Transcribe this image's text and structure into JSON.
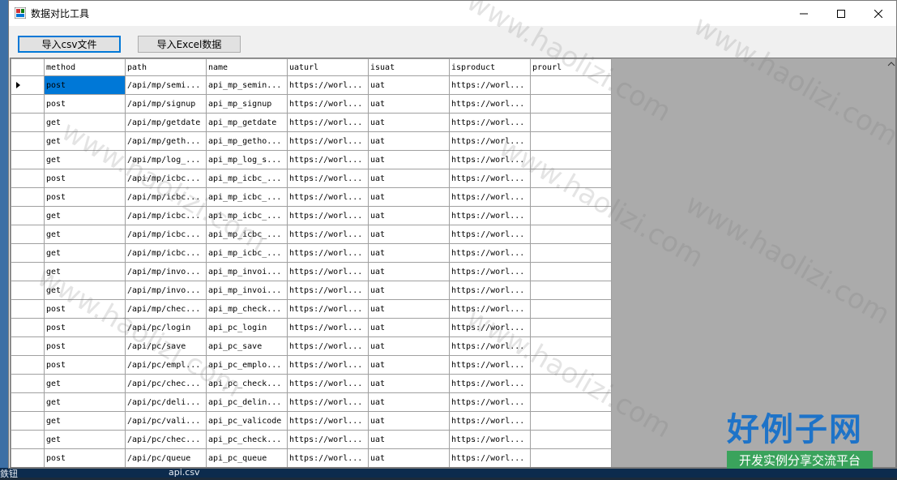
{
  "window": {
    "title": "数据对比工具",
    "controls": [
      "minimize",
      "maximize",
      "close"
    ]
  },
  "toolbar": {
    "import_csv_label": "导入csv文件",
    "import_excel_label": "导入Excel数据"
  },
  "grid": {
    "columns": [
      "method",
      "path",
      "name",
      "uaturl",
      "isuat",
      "isproduct",
      "prourl"
    ],
    "rows": [
      [
        "post",
        "/api/mp/semi...",
        "api_mp_semin...",
        "https://worl...",
        "uat",
        "https://worl...",
        ""
      ],
      [
        "post",
        "/api/mp/signup",
        "api_mp_signup",
        "https://worl...",
        "uat",
        "https://worl...",
        ""
      ],
      [
        "get",
        "/api/mp/getdate",
        "api_mp_getdate",
        "https://worl...",
        "uat",
        "https://worl...",
        ""
      ],
      [
        "get",
        "/api/mp/geth...",
        "api_mp_getho...",
        "https://worl...",
        "uat",
        "https://worl...",
        ""
      ],
      [
        "get",
        "/api/mp/log_...",
        "api_mp_log_s...",
        "https://worl...",
        "uat",
        "https://worl...",
        ""
      ],
      [
        "post",
        "/api/mp/icbc...",
        "api_mp_icbc_...",
        "https://worl...",
        "uat",
        "https://worl...",
        ""
      ],
      [
        "post",
        "/api/mp/icbc...",
        "api_mp_icbc_...",
        "https://worl...",
        "uat",
        "https://worl...",
        ""
      ],
      [
        "get",
        "/api/mp/icbc...",
        "api_mp_icbc_...",
        "https://worl...",
        "uat",
        "https://worl...",
        ""
      ],
      [
        "get",
        "/api/mp/icbc...",
        "api_mp_icbc_...",
        "https://worl...",
        "uat",
        "https://worl...",
        ""
      ],
      [
        "get",
        "/api/mp/icbc...",
        "api_mp_icbc_...",
        "https://worl...",
        "uat",
        "https://worl...",
        ""
      ],
      [
        "get",
        "/api/mp/invo...",
        "api_mp_invoi...",
        "https://worl...",
        "uat",
        "https://worl...",
        ""
      ],
      [
        "get",
        "/api/mp/invo...",
        "api_mp_invoi...",
        "https://worl...",
        "uat",
        "https://worl...",
        ""
      ],
      [
        "post",
        "/api/mp/chec...",
        "api_mp_check...",
        "https://worl...",
        "uat",
        "https://worl...",
        ""
      ],
      [
        "post",
        "/api/pc/login",
        "api_pc_login",
        "https://worl...",
        "uat",
        "https://worl...",
        ""
      ],
      [
        "post",
        "/api/pc/save",
        "api_pc_save",
        "https://worl...",
        "uat",
        "https://worl...",
        ""
      ],
      [
        "post",
        "/api/pc/empl...",
        "api_pc_emplo...",
        "https://worl...",
        "uat",
        "https://worl...",
        ""
      ],
      [
        "get",
        "/api/pc/chec...",
        "api_pc_check...",
        "https://worl...",
        "uat",
        "https://worl...",
        ""
      ],
      [
        "get",
        "/api/pc/deli...",
        "api_pc_delin...",
        "https://worl...",
        "uat",
        "https://worl...",
        ""
      ],
      [
        "get",
        "/api/pc/vali...",
        "api_pc_valicode",
        "https://worl...",
        "uat",
        "https://worl...",
        ""
      ],
      [
        "get",
        "/api/pc/chec...",
        "api_pc_check...",
        "https://worl...",
        "uat",
        "https://worl...",
        ""
      ],
      [
        "post",
        "/api/pc/queue",
        "api_pc_queue",
        "https://worl...",
        "uat",
        "https://worl...",
        ""
      ]
    ],
    "selected_row": 0,
    "selected_col": 0
  },
  "watermark": {
    "text": "www.haolizi.com",
    "logo_main": "好例子网",
    "logo_sub": "开发实例分享交流平台"
  },
  "taskbar": {
    "fragment_left": "鉄钮",
    "fragment_file": "api.csv"
  },
  "colors": {
    "selection": "#0078d7",
    "grid_background": "#ababab",
    "logo_blue": "#1e73c8",
    "logo_green": "#3aa35c"
  }
}
